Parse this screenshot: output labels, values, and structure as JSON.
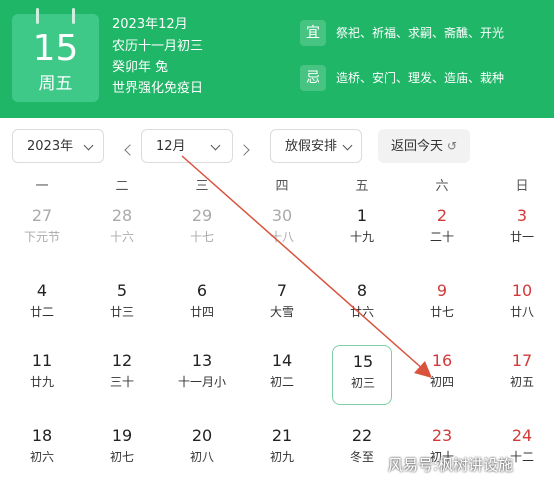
{
  "header": {
    "day_number": "15",
    "weekday": "周五",
    "date_title": "2023年12月",
    "lunar": "农历十一月初三",
    "ganzhi": "癸卯年 兔",
    "festival": "世界强化免疫日",
    "yi_label": "宜",
    "yi_items": "祭祀、祈福、求嗣、斋醮、开光",
    "ji_label": "忌",
    "ji_items": "造桥、安门、理发、造庙、栽种"
  },
  "controls": {
    "year_select": "2023年",
    "month_select": "12月",
    "holiday_select": "放假安排",
    "today_button": "返回今天",
    "today_icon": "↺"
  },
  "weekdays": [
    "一",
    "二",
    "三",
    "四",
    "五",
    "六",
    "日"
  ],
  "rows": [
    [
      {
        "day": "27",
        "sub": "下元节",
        "state": "other"
      },
      {
        "day": "28",
        "sub": "十六",
        "state": "other"
      },
      {
        "day": "29",
        "sub": "十七",
        "state": "other"
      },
      {
        "day": "30",
        "sub": "十八",
        "state": "other"
      },
      {
        "day": "1",
        "sub": "十九",
        "state": "normal"
      },
      {
        "day": "2",
        "sub": "二十",
        "state": "weekend"
      },
      {
        "day": "3",
        "sub": "廿一",
        "state": "weekend"
      }
    ],
    [
      {
        "day": "4",
        "sub": "廿二",
        "state": "normal"
      },
      {
        "day": "5",
        "sub": "廿三",
        "state": "normal"
      },
      {
        "day": "6",
        "sub": "廿四",
        "state": "normal"
      },
      {
        "day": "7",
        "sub": "大雪",
        "state": "normal"
      },
      {
        "day": "8",
        "sub": "廿六",
        "state": "normal"
      },
      {
        "day": "9",
        "sub": "廿七",
        "state": "weekend"
      },
      {
        "day": "10",
        "sub": "廿八",
        "state": "weekend"
      }
    ],
    [
      {
        "day": "11",
        "sub": "廿九",
        "state": "normal"
      },
      {
        "day": "12",
        "sub": "三十",
        "state": "normal"
      },
      {
        "day": "13",
        "sub": "十一月小",
        "state": "normal"
      },
      {
        "day": "14",
        "sub": "初二",
        "state": "normal"
      },
      {
        "day": "15",
        "sub": "初三",
        "state": "selected"
      },
      {
        "day": "16",
        "sub": "初四",
        "state": "weekend"
      },
      {
        "day": "17",
        "sub": "初五",
        "state": "weekend"
      }
    ],
    [
      {
        "day": "18",
        "sub": "初六",
        "state": "normal"
      },
      {
        "day": "19",
        "sub": "初七",
        "state": "normal"
      },
      {
        "day": "20",
        "sub": "初八",
        "state": "normal"
      },
      {
        "day": "21",
        "sub": "初九",
        "state": "normal"
      },
      {
        "day": "22",
        "sub": "冬至",
        "state": "normal"
      },
      {
        "day": "23",
        "sub": "初十",
        "state": "weekend"
      },
      {
        "day": "24",
        "sub": "十二",
        "state": "weekend"
      }
    ]
  ],
  "watermark": "风易号:枫树讲设施",
  "colors": {
    "header_green": "#1fb667",
    "card_green": "#3fc988",
    "weekend_red": "#d23a3a",
    "selected_border": "#7ecfa5",
    "annotation_arrow": "#d9533c"
  }
}
